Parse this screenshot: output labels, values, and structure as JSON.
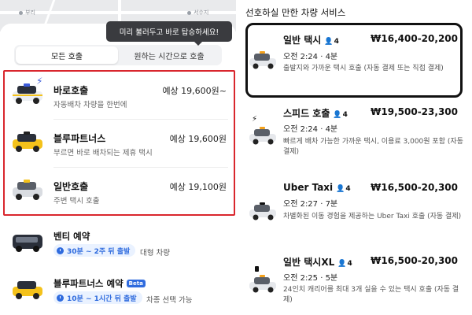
{
  "left": {
    "map": {
      "place1": "부리",
      "place2": "서수지"
    },
    "tooltip": "미리 불러두고 바로 탑승하세요!",
    "tabs": [
      {
        "label": "모든 호출"
      },
      {
        "label": "원하는 시간으로 호출"
      }
    ],
    "rides": [
      {
        "name": "바로호출",
        "desc": "자동배차 차량을 한번에",
        "price": "예상 19,600원~"
      },
      {
        "name": "블루파트너스",
        "desc": "부르면 바로 배차되는 제휴 택시",
        "price": "예상 19,600원"
      },
      {
        "name": "일반호출",
        "desc": "주변 택시 호출",
        "price": "예상 19,100원"
      }
    ],
    "reservations": [
      {
        "name": "벤티 예약",
        "badge": "30분 ~ 2주 뒤 출발",
        "sub": "대형 차량"
      },
      {
        "name": "블루파트너스 예약",
        "beta": "Beta",
        "badge": "10분 ~ 1시간 뒤 출발",
        "sub": "차종 선택 가능"
      }
    ]
  },
  "right": {
    "title": "선호하실 만한 차량 서비스",
    "options": [
      {
        "name": "일반 택시",
        "seats": "4",
        "price": "₩16,400-20,200",
        "time": "오전 2:24 · 4분",
        "desc": "출발지와 가까운 택시 호출 (자동 결제 또는 직접 결제)"
      },
      {
        "name": "스피드 호출",
        "seats": "4",
        "price": "₩19,500-23,300",
        "time": "오전 2:24 · 4분",
        "desc": "빠르게 배차 가능한 가까운 택시, 이용료 3,000원 포함 (자동 결제)"
      },
      {
        "name": "Uber Taxi",
        "seats": "4",
        "price": "₩16,500-20,300",
        "time": "오전 2:27 · 7분",
        "desc": "차별화된 이동 경험을 제공하는 Uber Taxi 호출 (자동 결제)"
      },
      {
        "name": "일반 택시XL",
        "seats": "4",
        "price": "₩16,500-20,300",
        "time": "오전 2:25 · 5분",
        "desc": "24인치 캐리어를 최대 3개 실을 수 있는 택시 호출 (자동 결제)"
      }
    ]
  }
}
